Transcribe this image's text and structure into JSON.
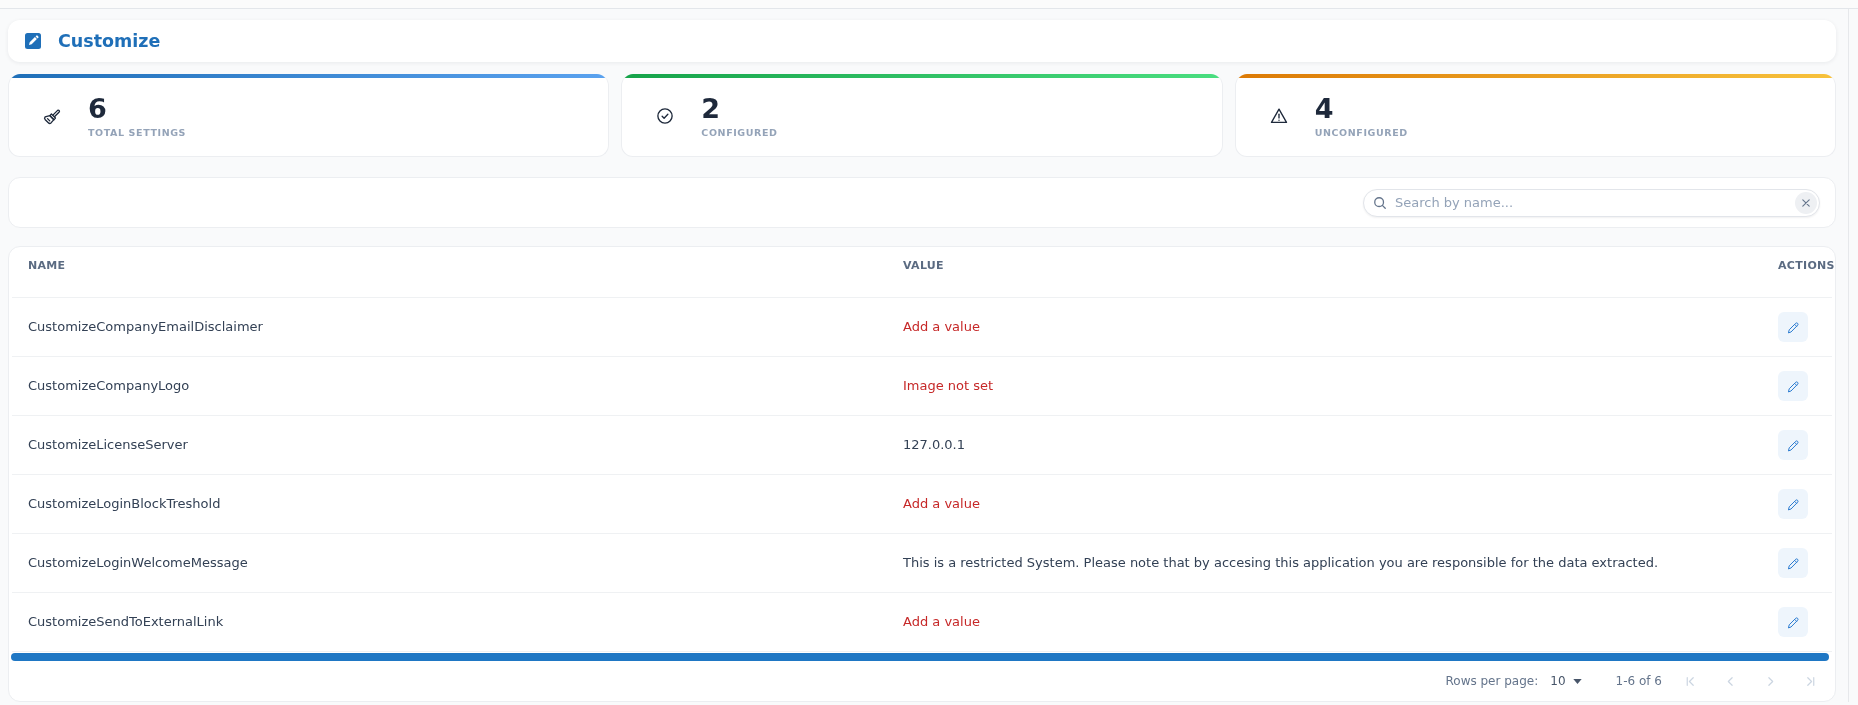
{
  "page_header": {
    "title": "Customize"
  },
  "stats": [
    {
      "kind": "total",
      "value": "6",
      "label": "TOTAL SETTINGS"
    },
    {
      "kind": "configured",
      "value": "2",
      "label": "CONFIGURED"
    },
    {
      "kind": "unconfigured",
      "value": "4",
      "label": "UNCONFIGURED"
    }
  ],
  "search": {
    "placeholder": "Search by name..."
  },
  "table": {
    "columns": [
      "NAME",
      "VALUE",
      "ACTIONS"
    ],
    "rows": [
      {
        "name": "CustomizeCompanyEmailDisclaimer",
        "value": "Add a value",
        "missing": true
      },
      {
        "name": "CustomizeCompanyLogo",
        "value": "Image not set",
        "missing": true
      },
      {
        "name": "CustomizeLicenseServer",
        "value": "127.0.0.1",
        "missing": false
      },
      {
        "name": "CustomizeLoginBlockTreshold",
        "value": "Add a value",
        "missing": true
      },
      {
        "name": "CustomizeLoginWelcomeMessage",
        "value": "This is a restricted System. Please note that by accesing this application you are responsible for the data extracted.",
        "missing": false
      },
      {
        "name": "CustomizeSendToExternalLink",
        "value": "Add a value",
        "missing": true
      }
    ]
  },
  "pagination": {
    "rows_per_page_label": "Rows per page:",
    "rows_per_page": "10",
    "range": "1-6 of 6",
    "buttons": [
      {
        "kind": "first",
        "disabled": true
      },
      {
        "kind": "previous",
        "disabled": true
      },
      {
        "kind": "next",
        "disabled": true
      },
      {
        "kind": "last",
        "disabled": true
      }
    ]
  }
}
